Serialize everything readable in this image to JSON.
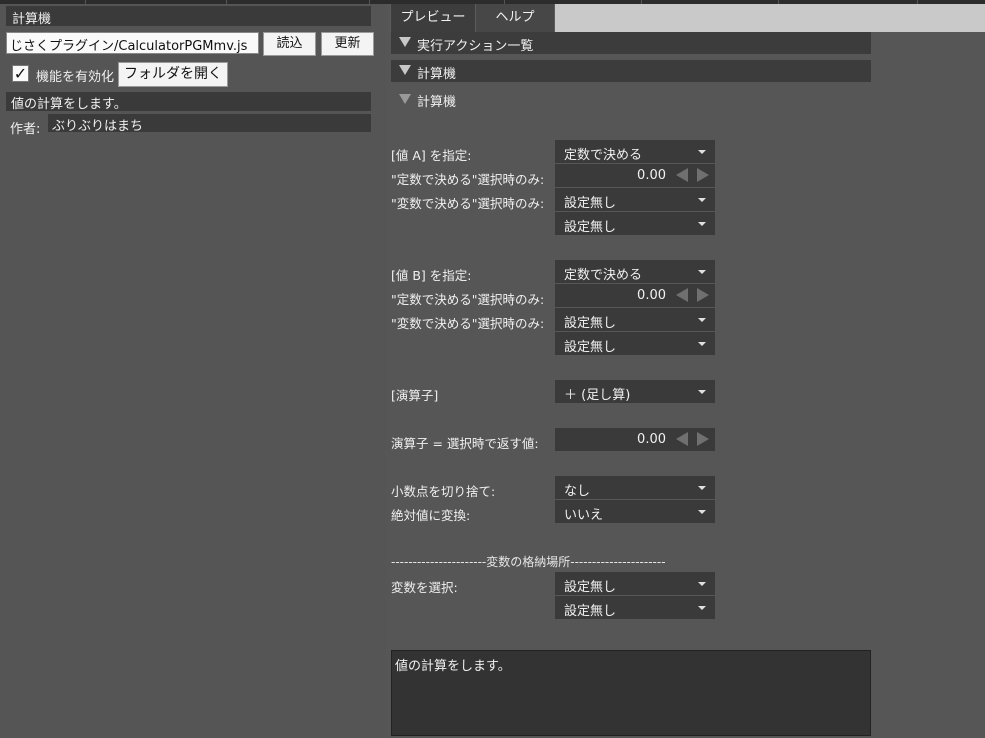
{
  "left": {
    "header_title": "計算機",
    "path_value": "じさくプラグイン/CalculatorPGMmv.js",
    "read_label": "読込",
    "update_label": "更新",
    "enable_label": "機能を有効化",
    "enable_checked": true,
    "folder_label": "フォルダを開く",
    "description": "値の計算をします。",
    "author_label": "作者:",
    "author": "ぶりぶりはまち"
  },
  "tabs": [
    {
      "label": "プレビュー",
      "active": true
    },
    {
      "label": "ヘルプ",
      "active": false
    }
  ],
  "sections": {
    "actions": "実行アクション一覧",
    "calc1": "計算機",
    "calc2": "計算機"
  },
  "value_a": {
    "label": "[値 A] を指定:",
    "mode": "定数で決める",
    "const_label": "\"定数で決める\"選択時のみ:",
    "const_value": "0.00",
    "var_label": "\"変数で決める\"選択時のみ:",
    "var1": "設定無し",
    "var2": "設定無し"
  },
  "value_b": {
    "label": "[値 B] を指定:",
    "mode": "定数で決める",
    "const_label": "\"定数で決める\"選択時のみ:",
    "const_value": "0.00",
    "var_label": "\"変数で決める\"選択時のみ:",
    "var1": "設定無し",
    "var2": "設定無し"
  },
  "operator": {
    "label": "[演算子]",
    "value": "＋ (足し算)"
  },
  "op_eq": {
    "label": "演算子 = 選択時で返す値:",
    "value": "0.00"
  },
  "truncate": {
    "label": "小数点を切り捨て:",
    "value": "なし"
  },
  "absolute": {
    "label": "絶対値に変換:",
    "value": "いいえ"
  },
  "storage": {
    "divider": "----------------------変数の格納場所----------------------",
    "label": "変数を選択:",
    "var1": "設定無し",
    "var2": "設定無し"
  },
  "help_text": "値の計算をします。"
}
